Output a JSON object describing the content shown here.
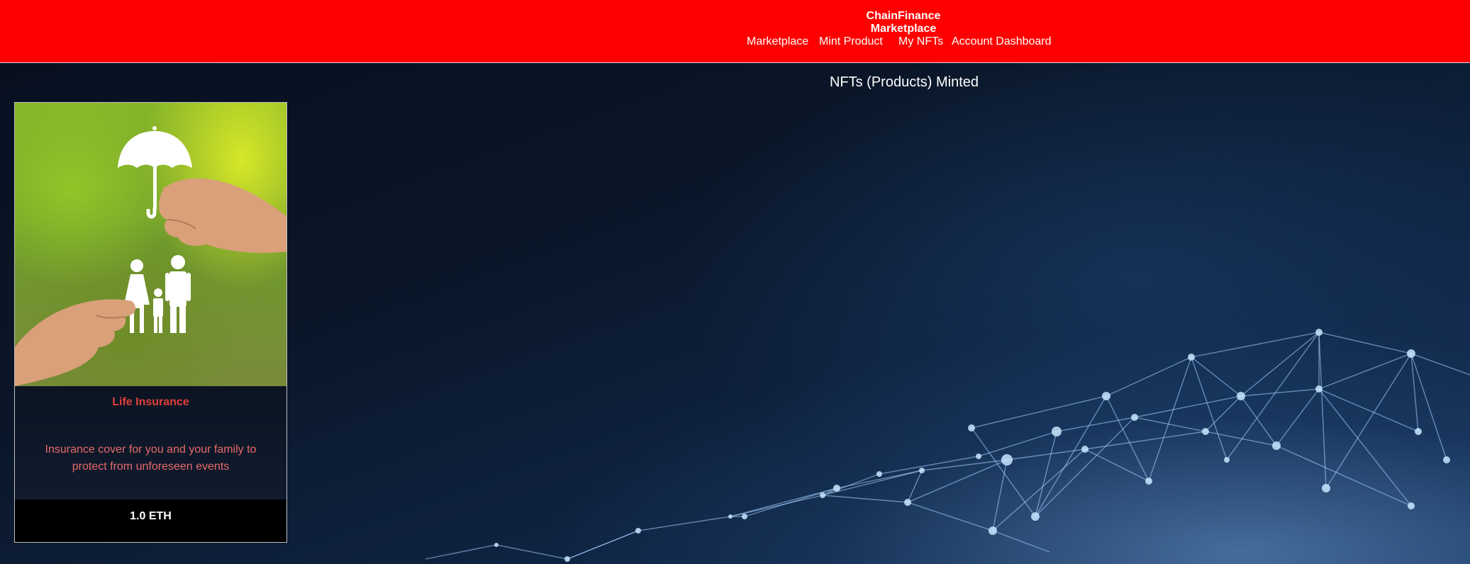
{
  "header": {
    "brand": "ChainFinance Marketplace",
    "nav": {
      "marketplace": "Marketplace",
      "mint_product": "Mint Product",
      "my_nfts": "My NFTs",
      "account_dashboard": "Account Dashboard"
    },
    "background_color": "#ff0000"
  },
  "main": {
    "heading": "NFTs (Products) Minted",
    "cards": [
      {
        "image": "umbrella-family-insurance-image",
        "title": "Life Insurance",
        "description": "Insurance cover for you and your family to protect from unforeseen events",
        "price": "1.0 ETH",
        "title_color": "#e0403a",
        "description_color": "#e86a6a"
      }
    ]
  },
  "background": {
    "image": "blockchain-network-background",
    "color": "#0b1322"
  }
}
